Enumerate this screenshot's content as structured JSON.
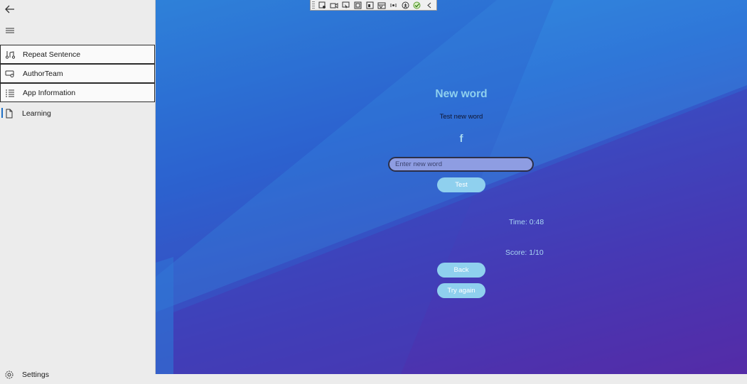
{
  "sidebar": {
    "items": [
      {
        "label": "Repeat Sentence",
        "icon": "music-note-icon"
      },
      {
        "label": "AuthorTeam",
        "icon": "chat-bubble-icon"
      },
      {
        "label": "App Information",
        "icon": "list-icon"
      },
      {
        "label": "Learning",
        "icon": "document-icon"
      }
    ],
    "settings_label": "Settings"
  },
  "main": {
    "title": "New word",
    "subtitle": "Test new word",
    "letter": "f",
    "input_placeholder": "Enter new word",
    "input_value": "",
    "test_button": "Test",
    "time": "Time: 0:48",
    "score": "Score: 1/10",
    "back_button": "Back",
    "try_again_button": "Try again"
  },
  "colors": {
    "accent": "#8fd0ee",
    "selection_bar": "#1f6fc4",
    "bg_top": "#2f8fdf",
    "bg_bottom": "#5a2aa3"
  }
}
